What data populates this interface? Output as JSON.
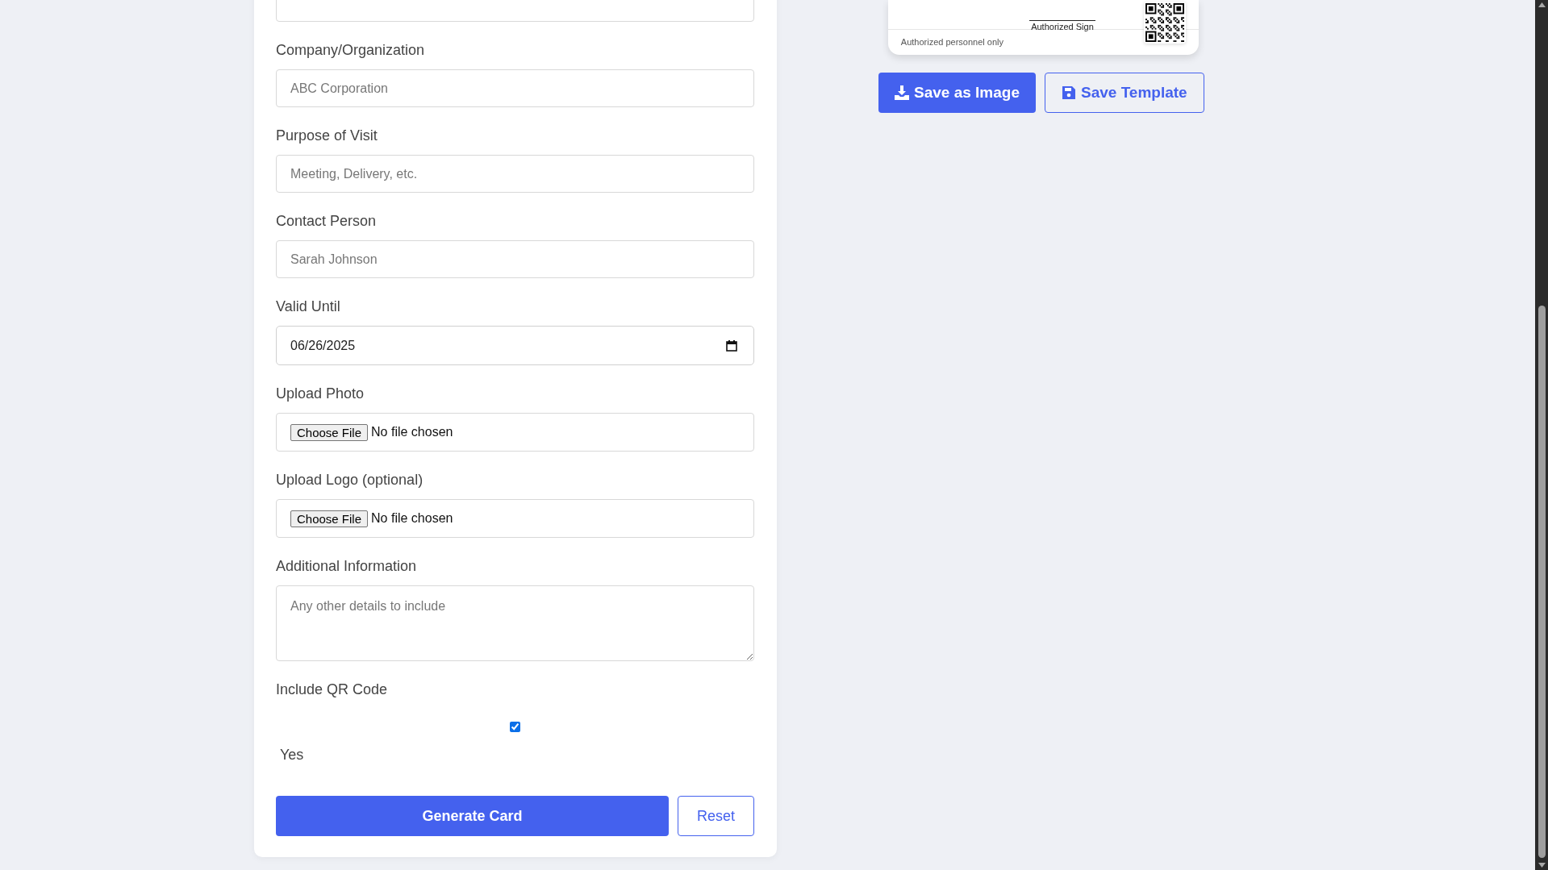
{
  "form": {
    "fields": [
      {
        "kind": "text"
      },
      {
        "kind": "text",
        "label": "Company/Organization",
        "placeholder": "ABC Corporation"
      },
      {
        "kind": "text",
        "label": "Purpose of Visit",
        "placeholder": "Meeting, Delivery, etc."
      },
      {
        "kind": "text",
        "label": "Contact Person",
        "placeholder": "Sarah Johnson"
      },
      {
        "kind": "date",
        "label": "Valid Until",
        "value": "06/26/2025"
      },
      {
        "kind": "file",
        "label": "Upload Photo",
        "button": "Choose File",
        "status": "No file chosen"
      },
      {
        "kind": "file",
        "label": "Upload Logo (optional)",
        "button": "Choose File",
        "status": "No file chosen"
      },
      {
        "kind": "textarea",
        "label": "Additional Information",
        "placeholder": "Any other details to include"
      },
      {
        "kind": "checkbox",
        "label": "Include QR Code",
        "option": "Yes",
        "checked": true
      }
    ],
    "buttons": [
      {
        "kind": "primary",
        "label": "Generate Card"
      },
      {
        "kind": "outline",
        "label": "Reset"
      }
    ]
  },
  "preview": {
    "signature_label": "Authorized Sign",
    "footer": "Authorized personnel only"
  },
  "actions": [
    {
      "kind": "primary",
      "label": "Save as Image"
    },
    {
      "kind": "outline",
      "label": "Save Template"
    }
  ]
}
